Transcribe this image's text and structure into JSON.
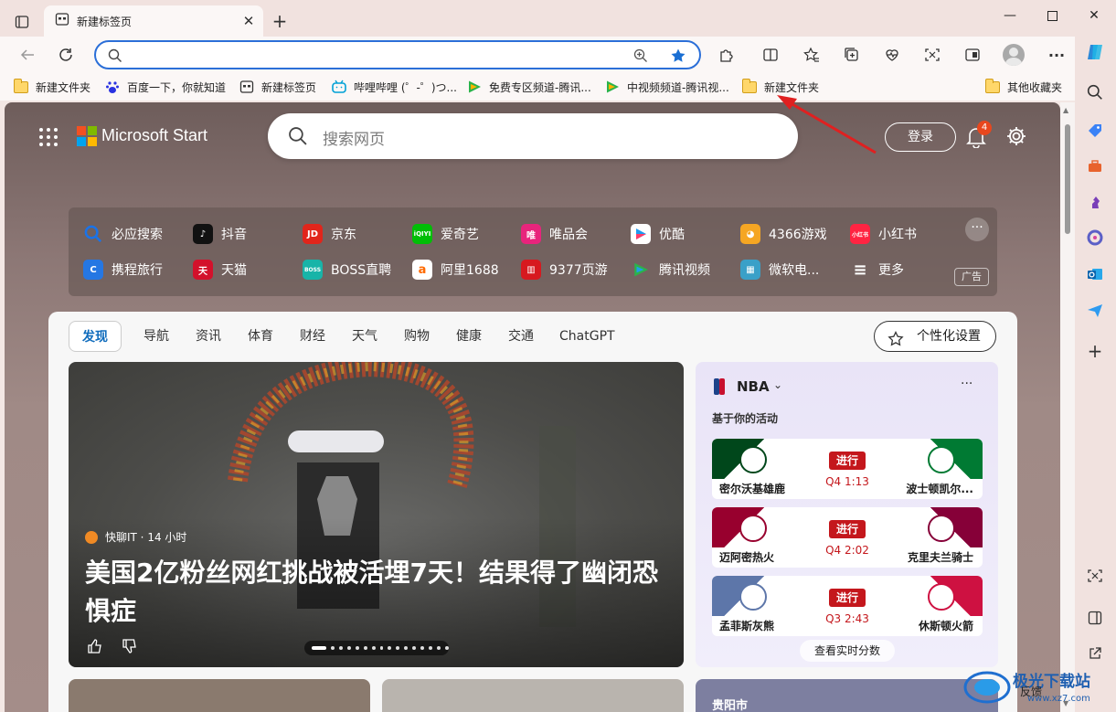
{
  "tab": {
    "title": "新建标签页"
  },
  "address": {
    "value": ""
  },
  "bookmarks": [
    {
      "label": "新建文件夹",
      "icon": "folder-icon"
    },
    {
      "label": "百度一下，你就知道",
      "icon": "baidu-icon"
    },
    {
      "label": "新建标签页",
      "icon": "newtab-icon"
    },
    {
      "label": "哔哩哔哩 (゜-゜)つ...",
      "icon": "bilibili-icon"
    },
    {
      "label": "免费专区频道-腾讯...",
      "icon": "tencent-video-icon"
    },
    {
      "label": "中视频频道-腾讯视...",
      "icon": "tencent-video-icon"
    },
    {
      "label": "新建文件夹",
      "icon": "folder-icon"
    },
    {
      "label": "其他收藏夹",
      "icon": "folder-icon"
    }
  ],
  "page": {
    "brand": "Microsoft Start",
    "search_placeholder": "搜索网页",
    "login": "登录",
    "notification_count": "4"
  },
  "quicklinks": {
    "row1": [
      {
        "label": "必应搜索",
        "color": "#1a73e8"
      },
      {
        "label": "抖音",
        "color": "#111111"
      },
      {
        "label": "京东",
        "color": "#e1251b"
      },
      {
        "label": "爱奇艺",
        "color": "#00be06"
      },
      {
        "label": "唯品会",
        "color": "#e8247c"
      },
      {
        "label": "优酷",
        "color": "#1f9af0"
      },
      {
        "label": "4366游戏",
        "color": "#f5a623"
      },
      {
        "label": "小红书",
        "color": "#ff2442"
      }
    ],
    "row2": [
      {
        "label": "携程旅行",
        "color": "#2577e3"
      },
      {
        "label": "天猫",
        "color": "#d3112b"
      },
      {
        "label": "BOSS直聘",
        "color": "#18b4a8"
      },
      {
        "label": "阿里1688",
        "color": "#ff6a00"
      },
      {
        "label": "9377页游",
        "color": "#d7191f"
      },
      {
        "label": "腾讯视频",
        "color": "#2bb34a"
      },
      {
        "label": "微软电...",
        "color": "#3aa0c8"
      },
      {
        "label": "更多",
        "color": "transparent"
      }
    ],
    "ad": "广告"
  },
  "feed": {
    "tabs": [
      "发现",
      "导航",
      "资讯",
      "体育",
      "财经",
      "天气",
      "购物",
      "健康",
      "交通",
      "ChatGPT"
    ],
    "personalize": "个性化设置",
    "hero": {
      "source": "快聊IT · 14 小时",
      "headline": "美国2亿粉丝网红挑战被活埋7天！结果得了幽闭恐惧症"
    },
    "nba": {
      "title": "NBA",
      "subtitle": "基于你的活动",
      "games": [
        {
          "home": "密尔沃基雄鹿",
          "away": "波士顿凯尔...",
          "status": "进行",
          "time": "Q4 1:13",
          "home_color": "#00471b",
          "away_color": "#007a33"
        },
        {
          "home": "迈阿密热火",
          "away": "克里夫兰骑士",
          "status": "进行",
          "time": "Q4 2:02",
          "home_color": "#98002e",
          "away_color": "#860038"
        },
        {
          "home": "孟菲斯灰熊",
          "away": "休斯顿火箭",
          "status": "进行",
          "time": "Q3 2:43",
          "home_color": "#5d76a9",
          "away_color": "#ce1141"
        }
      ],
      "live_scores": "查看实时分数"
    },
    "bottom_card": "贵阳市"
  },
  "sidebar_footer": "反馈"
}
